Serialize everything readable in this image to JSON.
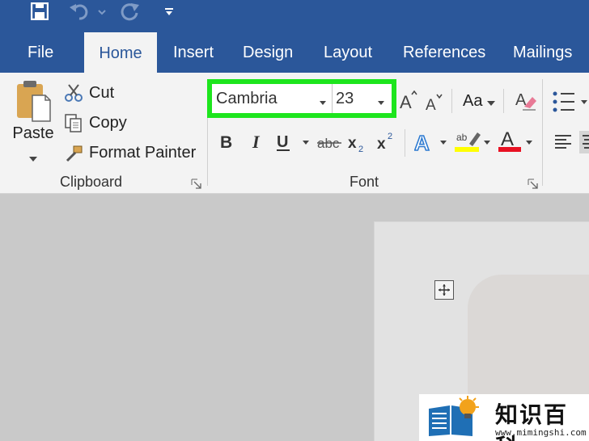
{
  "tabs": {
    "file": "File",
    "home": "Home",
    "insert": "Insert",
    "design": "Design",
    "layout": "Layout",
    "references": "References",
    "mailings": "Mailings"
  },
  "clipboard": {
    "paste": "Paste",
    "cut": "Cut",
    "copy": "Copy",
    "format_painter": "Format Painter",
    "group_label": "Clipboard"
  },
  "font": {
    "font_name": "Cambria",
    "font_size": "23",
    "change_case": "Aa",
    "group_label": "Font",
    "highlight_color": "#1de51d",
    "text_color_bar": "#e81123",
    "highlighter_bar": "#ffff00"
  },
  "watermark": {
    "title": "知识百科",
    "url": "www.mimingshi.com"
  },
  "colors": {
    "accent": "#2b579a",
    "ribbon": "#f3f3f3",
    "canvas": "#c9c9c9"
  }
}
